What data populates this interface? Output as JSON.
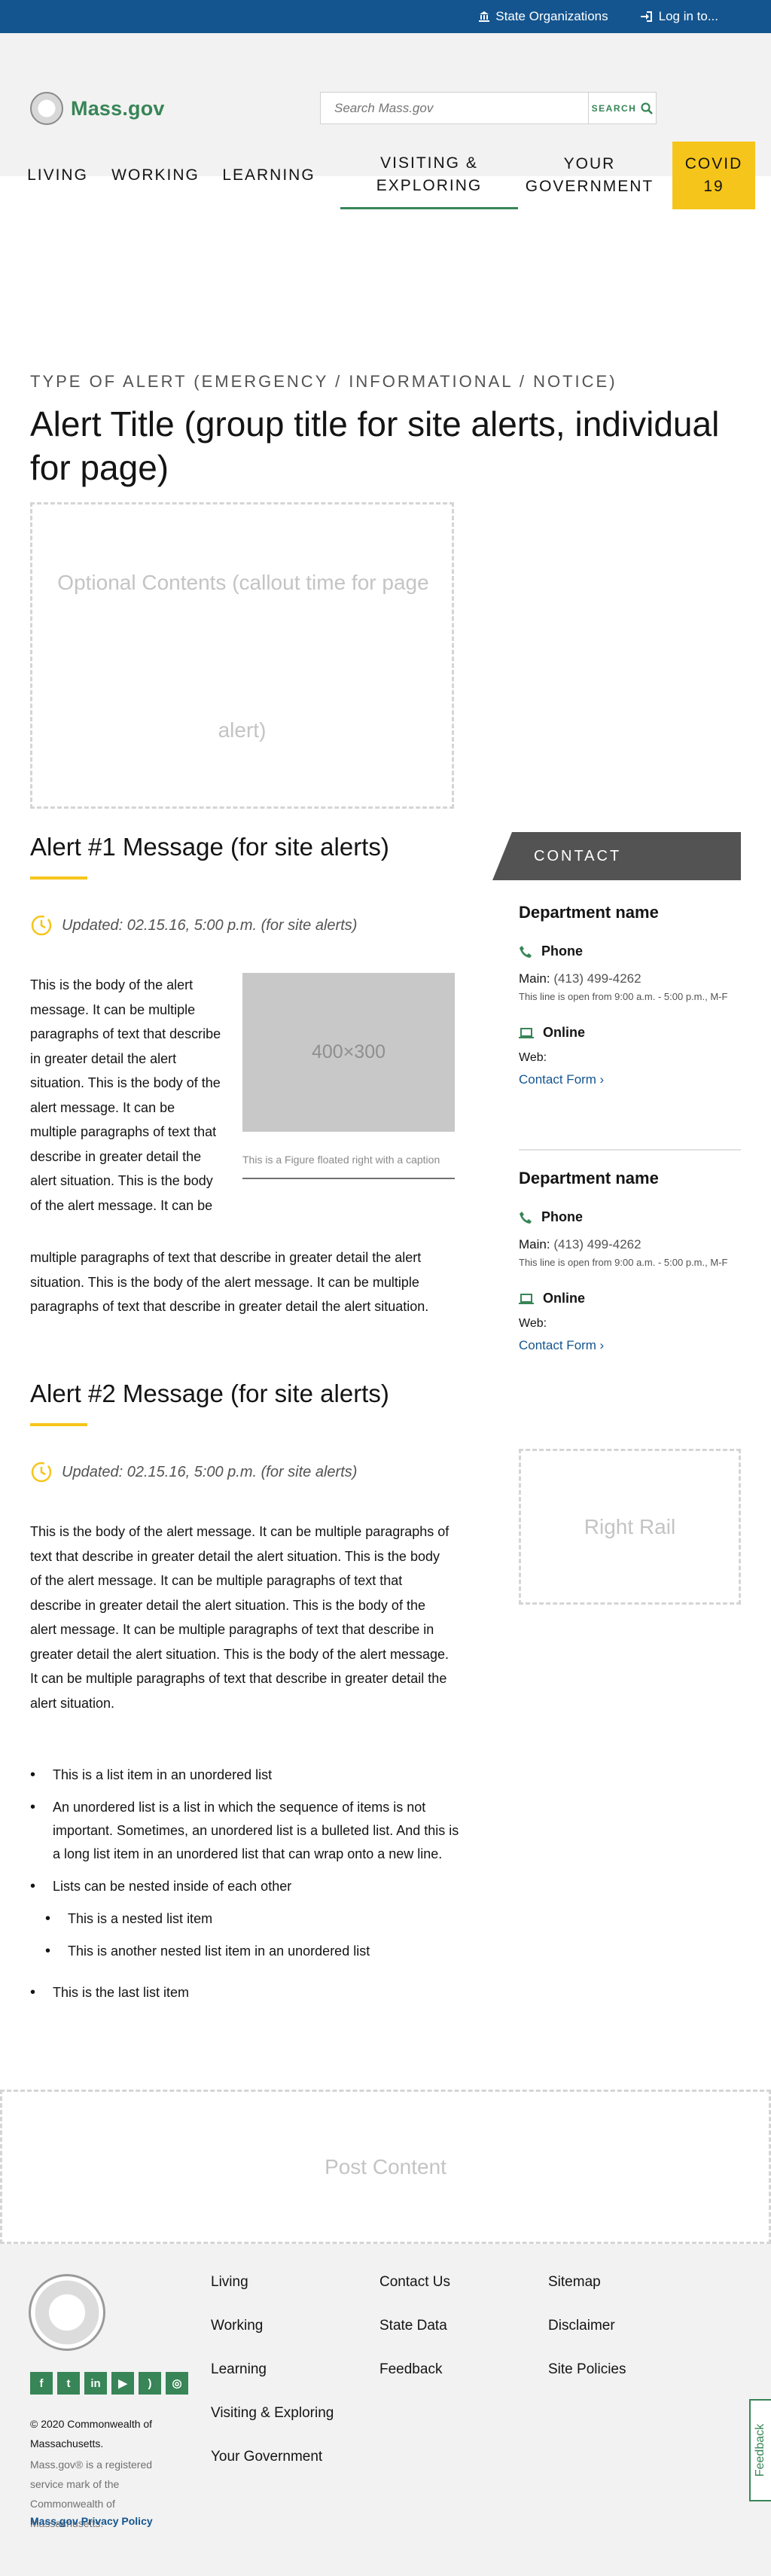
{
  "utility": {
    "state_orgs": "State Organizations",
    "login": "Log in to..."
  },
  "header": {
    "logo_text": "Mass.gov",
    "search_placeholder": "Search Mass.gov",
    "search_button": "SEARCH"
  },
  "nav": {
    "items": [
      {
        "label": "LIVING"
      },
      {
        "label": "WORKING"
      },
      {
        "label": "LEARNING"
      },
      {
        "label": "VISITING & EXPLORING"
      },
      {
        "label": "YOUR GOVERNMENT"
      },
      {
        "label": "COVID 19"
      }
    ]
  },
  "page": {
    "alert_type": "TYPE OF ALERT (EMERGENCY / INFORMATIONAL / NOTICE)",
    "title": "Alert Title (group title for site alerts, individual for page)",
    "callout_line1": "Optional Contents (callout time for page",
    "callout_line2": "alert)"
  },
  "alert1": {
    "heading": "Alert #1 Message (for site alerts)",
    "updated": "Updated: 02.15.16, 5:00 p.m. (for site alerts)",
    "body_wrap": "This is the body of the alert message. It can be multiple paragraphs of text that describe in greater detail the alert situation. This is the body of the alert message. It can be multiple paragraphs of text that describe in greater detail the alert situation. This is the body of the alert message. It can be",
    "body_full": "multiple paragraphs of text that describe in greater detail the alert situation. This is the body of the alert message. It can be multiple paragraphs of text that describe in greater detail the alert situation.",
    "figure_label": "400×300",
    "figure_caption": "This is a Figure floated right with a caption"
  },
  "alert2": {
    "heading": "Alert #2 Message (for site alerts)",
    "updated": "Updated: 02.15.16, 5:00 p.m. (for site alerts)",
    "body": "This is the body of the alert message. It can be multiple paragraphs of text that describe in greater detail the alert situation. This is the body of the alert message. It can be multiple paragraphs of text that describe in greater detail the alert situation. This is the body of the alert message. It can be multiple paragraphs of text that describe in greater detail the alert situation. This is the body of the alert message. It can be multiple paragraphs of text that describe in greater detail the alert situation.",
    "list": [
      "This is a list item in an unordered list",
      "An unordered list is a list in which the sequence of items is not important. Sometimes, an unordered list is a bulleted list. And this is a long list item in an unordered list that can wrap onto a new line.",
      "Lists can be nested inside of each other",
      "This is a nested list item",
      "This is another nested list item in an unordered list",
      "This is the last list item"
    ]
  },
  "contact": {
    "header": "CONTACT",
    "departments": [
      {
        "name": "Department name",
        "phone_label": "Phone",
        "main_label": "Main:",
        "main_number": "(413) 499-4262",
        "hours": "This line is open from 9:00 a.m. - 5:00 p.m., M-F",
        "online_label": "Online",
        "web_label": "Web:",
        "contact_form": "Contact Form"
      },
      {
        "name": "Department name",
        "phone_label": "Phone",
        "main_label": "Main:",
        "main_number": "(413) 499-4262",
        "hours": "This line is open from 9:00 a.m. - 5:00 p.m., M-F",
        "online_label": "Online",
        "web_label": "Web:",
        "contact_form": "Contact Form"
      }
    ]
  },
  "right_rail": "Right Rail",
  "post_content": "Post Content",
  "footer": {
    "col1": [
      "Living",
      "Working",
      "Learning",
      "Visiting & Exploring",
      "Your Government"
    ],
    "col2": [
      "Contact Us",
      "State Data",
      "Feedback"
    ],
    "col3": [
      "Sitemap",
      "Disclaimer",
      "Site Policies"
    ],
    "social": [
      "facebook-icon",
      "twitter-icon",
      "linkedin-icon",
      "youtube-icon",
      "rss-icon",
      "instagram-icon"
    ],
    "copyright": "© 2020 Commonwealth of Massachusetts.",
    "service_mark": "Mass.gov® is a registered service mark of the Commonwealth of Massachusetts.",
    "privacy": "Mass.gov Privacy Policy"
  },
  "feedback_tab": "Feedback",
  "colors": {
    "blue": "#14558f",
    "green": "#388557",
    "yellow": "#f6c51b",
    "gray_dark": "#535353"
  }
}
